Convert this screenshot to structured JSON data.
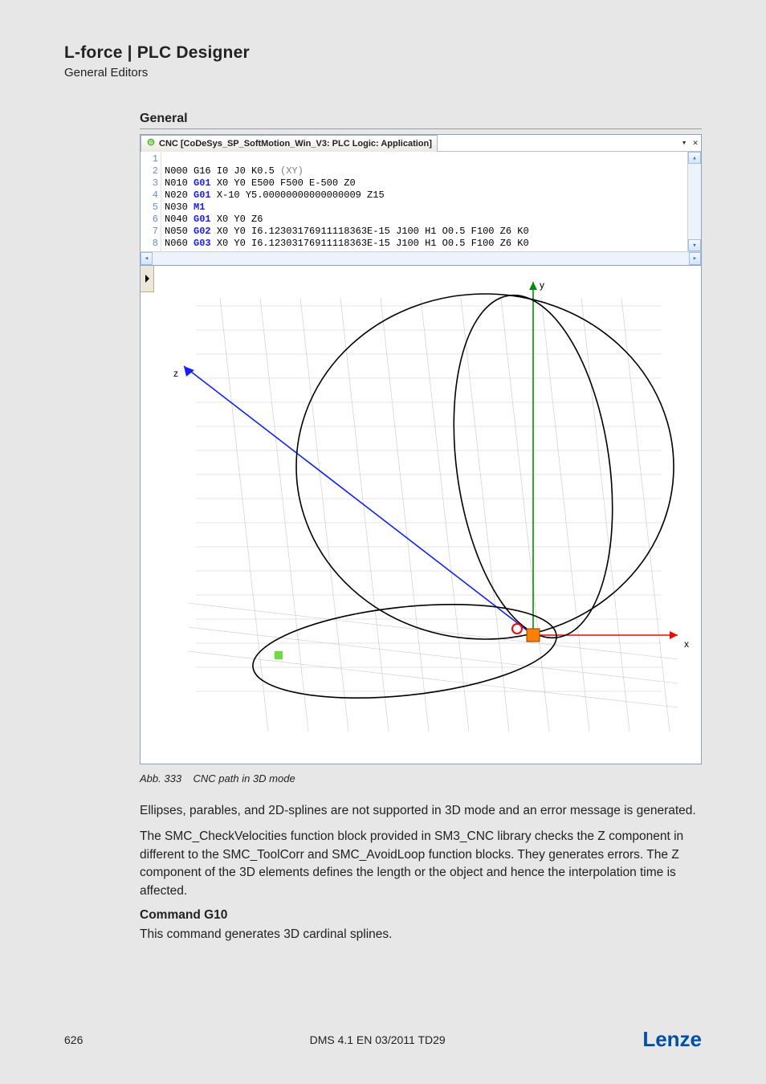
{
  "header": {
    "title": "L-force | PLC Designer",
    "subtitle": "General Editors"
  },
  "section_heading": "General",
  "ide": {
    "tab_title": "CNC [CoDeSys_SP_SoftMotion_Win_V3: PLC Logic: Application]",
    "tab_dropdown": "▾",
    "tab_close": "✕",
    "up_arrow": "▴",
    "down_arrow": "▾",
    "left_arrow": "◂",
    "right_arrow": "▸",
    "code_lines": [
      {
        "n": "1",
        "raw": ""
      },
      {
        "n": "2",
        "segs": [
          {
            "t": "N000 G16 I0 J0 K0.5 "
          },
          {
            "t": "(XY)",
            "c": "grey"
          }
        ]
      },
      {
        "n": "3",
        "segs": [
          {
            "t": "N010 "
          },
          {
            "t": "G01",
            "c": "kw"
          },
          {
            "t": " X0 Y0 E500 F500 E-500 Z0"
          }
        ]
      },
      {
        "n": "4",
        "segs": [
          {
            "t": "N020 "
          },
          {
            "t": "G01",
            "c": "kw"
          },
          {
            "t": " X-10 Y5.00000000000000009 Z15"
          }
        ]
      },
      {
        "n": "5",
        "segs": [
          {
            "t": "N030 "
          },
          {
            "t": "M1",
            "c": "kw"
          }
        ]
      },
      {
        "n": "6",
        "segs": [
          {
            "t": "N040 "
          },
          {
            "t": "G01",
            "c": "kw"
          },
          {
            "t": " X0 Y0 Z6"
          }
        ]
      },
      {
        "n": "7",
        "segs": [
          {
            "t": "N050 "
          },
          {
            "t": "G02",
            "c": "kw"
          },
          {
            "t": " X0 Y0 I6.12303176911118363E-15 J100 H1 O0.5 F100 Z6 K0"
          }
        ]
      },
      {
        "n": "8",
        "segs": [
          {
            "t": "N060 "
          },
          {
            "t": "G03",
            "c": "kw"
          },
          {
            "t": " X0 Y0 I6.12303176911118363E-15 J100"
          },
          {
            "t": " H1"
          },
          {
            "t": " O0.5 F100 Z6 K0"
          }
        ]
      }
    ]
  },
  "axes": {
    "x": "x",
    "y": "y",
    "z": "z"
  },
  "figure": {
    "num": "Abb. 333",
    "caption": "CNC path in 3D mode"
  },
  "body": {
    "p1": "Ellipses, parables, and 2D-splines are not supported in 3D mode and an error message is generated.",
    "p2": "The SMC_CheckVelocities function block provided in SM3_CNC library checks the Z component in different to the SMC_ToolCorr and SMC_AvoidLoop function blocks. They generates errors. The Z component of the 3D elements defines the length or the object and hence the interpolation time is affected.",
    "h1": "Command G10",
    "p3": "This command generates 3D cardinal splines."
  },
  "footer": {
    "page": "626",
    "center": "DMS 4.1 EN 03/2011 TD29",
    "logo": "Lenze"
  }
}
